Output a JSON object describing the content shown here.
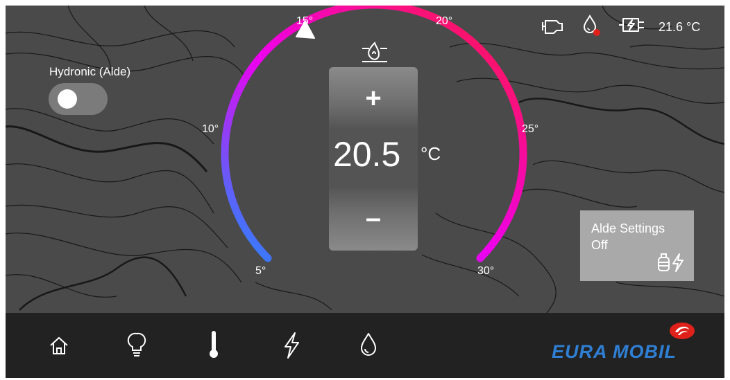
{
  "gauge": {
    "tick_labels": [
      "5°",
      "10°",
      "15°",
      "20°",
      "25°",
      "30°"
    ],
    "min": 5,
    "max": 30,
    "marker_value": 15,
    "gradient_colors": [
      "#1e8cff",
      "#ee00ee",
      "#ff1a3c"
    ]
  },
  "thermostat": {
    "setpoint": "20.5",
    "unit": "°C",
    "plus_label": "+",
    "minus_label": "–",
    "mode_icon": "fan-heater-icon"
  },
  "hydronic": {
    "label": "Hydronic (Alde)",
    "enabled": false
  },
  "alde_settings": {
    "title": "Alde Settings",
    "state": "Off",
    "icons": [
      "gas-bottle-icon",
      "lightning-icon"
    ]
  },
  "status_bar": {
    "icons": [
      "engine-icon",
      "water-drop-alert-icon",
      "shore-power-icon"
    ],
    "ambient_temperature": "21.6 °C",
    "alert_color": "#e0201a"
  },
  "nav": {
    "items": [
      "home-icon",
      "light-bulb-icon",
      "thermometer-icon",
      "lightning-icon",
      "water-drop-icon"
    ],
    "active": "thermometer-icon"
  },
  "brand": {
    "name": "EURA MOBIL",
    "color": "#2f7fd4"
  }
}
